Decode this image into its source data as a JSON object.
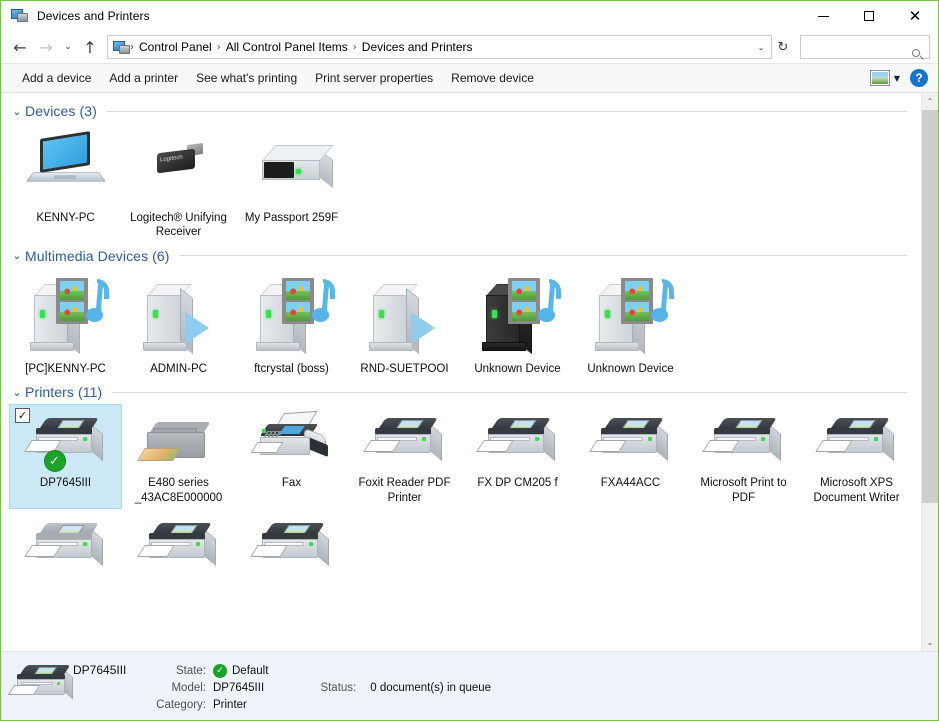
{
  "window": {
    "title": "Devices and Printers",
    "icon": "devices-printers-icon",
    "minimize_label": "Minimize",
    "maximize_label": "Maximize",
    "close_label": "Close"
  },
  "addressbar": {
    "back_label": "Back",
    "forward_label": "Forward",
    "recent_label": "Recent locations",
    "up_label": "Up",
    "separator": "›",
    "crumbs": [
      "Control Panel",
      "All Control Panel Items",
      "Devices and Printers"
    ],
    "dropdown_label": "Previous locations",
    "refresh_label": "Refresh",
    "search": {
      "value": "",
      "placeholder": ""
    }
  },
  "commandbar": {
    "items": [
      "Add a device",
      "Add a printer",
      "See what's printing",
      "Print server properties",
      "Remove device"
    ],
    "view_icon": "view-options-icon",
    "view_dropdown": "▼",
    "help_label": "?"
  },
  "groups": [
    {
      "title": "Devices (3)",
      "chevron": "⌄",
      "kind": "dev",
      "items": [
        {
          "label": "KENNY-PC",
          "icon": "laptop-icon"
        },
        {
          "label": "Logitech® Unifying Receiver",
          "icon": "usb-receiver-icon"
        },
        {
          "label": "My Passport 259F",
          "icon": "external-drive-icon"
        }
      ]
    },
    {
      "title": "Multimedia Devices (6)",
      "chevron": "⌄",
      "kind": "mm",
      "items": [
        {
          "label": "[PC]KENNY-PC",
          "icon": "media-device-icon",
          "media": true,
          "dark": false,
          "play": false
        },
        {
          "label": "ADMIN-PC",
          "icon": "media-device-icon",
          "media": false,
          "dark": false,
          "play": true
        },
        {
          "label": "ftcrystal (boss)",
          "icon": "media-device-icon",
          "media": true,
          "dark": false,
          "play": false
        },
        {
          "label": "RND-SUETPOOI",
          "icon": "media-device-icon",
          "media": false,
          "dark": false,
          "play": true
        },
        {
          "label": "Unknown Device",
          "icon": "media-device-icon",
          "media": true,
          "dark": true,
          "play": false
        },
        {
          "label": "Unknown Device",
          "icon": "media-device-icon",
          "media": true,
          "dark": false,
          "play": false
        }
      ]
    },
    {
      "title": "Printers (11)",
      "chevron": "⌄",
      "kind": "pr",
      "items": [
        {
          "label": "DP7645III",
          "icon": "printer-icon",
          "selected": true,
          "checked": true,
          "checkmark": "✓",
          "default": true,
          "default_mark": "✓",
          "style": "laser"
        },
        {
          "label": "E480 series _43AC8E000000",
          "icon": "printer-icon",
          "style": "mfp"
        },
        {
          "label": "Fax",
          "icon": "fax-icon",
          "style": "fax"
        },
        {
          "label": "Foxit Reader PDF Printer",
          "icon": "printer-icon",
          "style": "laser"
        },
        {
          "label": "FX DP CM205 f",
          "icon": "printer-icon",
          "style": "laser"
        },
        {
          "label": "FXA44ACC",
          "icon": "printer-icon",
          "style": "laser"
        },
        {
          "label": "Microsoft Print to PDF",
          "icon": "printer-icon",
          "style": "laser"
        },
        {
          "label": "Microsoft XPS Document Writer",
          "icon": "printer-icon",
          "style": "laser"
        },
        {
          "label": "",
          "icon": "printer-icon",
          "style": "gray"
        },
        {
          "label": "",
          "icon": "printer-icon",
          "style": "laser"
        },
        {
          "label": "",
          "icon": "printer-icon",
          "style": "laser"
        }
      ]
    }
  ],
  "scrollbar": {
    "up_arrow": "⌃",
    "down_arrow": "⌄",
    "thumb_label": "Vertical scrollbar thumb"
  },
  "statusbar": {
    "icon": "printer-icon",
    "name": "DP7645III",
    "state_label": "State:",
    "state_value": "Default",
    "state_mark": "✓",
    "model_label": "Model:",
    "model_value": "DP7645III",
    "category_label": "Category:",
    "category_value": "Printer",
    "status_label": "Status:",
    "status_value": "0 document(s) in queue"
  },
  "colors": {
    "selection": "#cce8f7",
    "group_title": "#2e5c9a",
    "default_badge": "#1ba329",
    "help_blue": "#1574c8",
    "window_border": "#7cc04a",
    "statusbar_bg": "#eff3fa"
  }
}
